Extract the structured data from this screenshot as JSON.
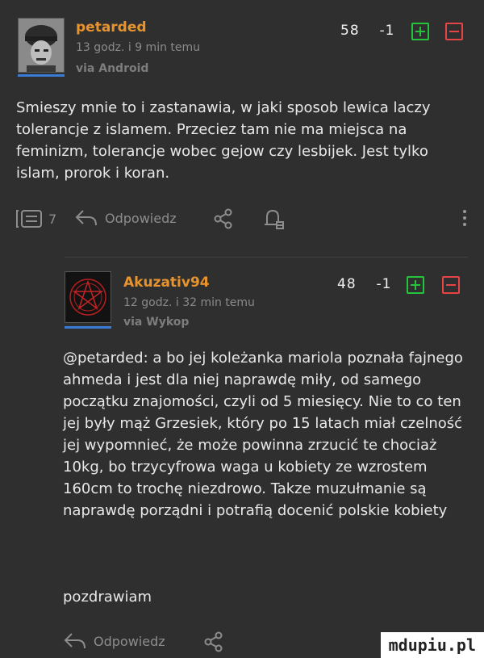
{
  "comment1": {
    "author": "petarded",
    "time": "13 godz. i 9 min temu",
    "via": "via Android",
    "score": "58",
    "score_delta": "-1",
    "body": "Smieszy mnie to i zastanawia, w jaki sposob lewica laczy tolerancje z islamem. Przeciez tam nie ma miejsca na feminizm, tolerancje wobec gejow czy lesbijek. Jest tylko islam, prorok i koran.",
    "replies_count": "7",
    "reply_label": "Odpowiedz"
  },
  "comment2": {
    "author": "Akuzativ94",
    "time": "12 godz. i 32 min temu",
    "via": "via Wykop",
    "score": "48",
    "score_delta": "-1",
    "body": "@petarded: a bo jej koleżanka mariola poznała fajnego ahmeda i jest dla niej naprawdę miły, od samego początku znajomości, czyli od 5 miesięcy. Nie to co ten jej były mąż Grzesiek, który po 15 latach miał czelność jej wypomnieć, że może powinna zrzucić te chociaż 10kg, bo trzycyfrowa waga u kobiety ze wzrostem 160cm to trochę niezdrowo. Takze muzułmanie są naprawdę porządni i potrafią docenić polskie kobiety",
    "signoff": "pozdrawiam",
    "reply_label": "Odpowiedz"
  },
  "watermark": "mdupiu.pl",
  "colors": {
    "background": "#2f2f2f",
    "author": "#e8932c",
    "plus": "#25c53b",
    "minus": "#e54545"
  }
}
